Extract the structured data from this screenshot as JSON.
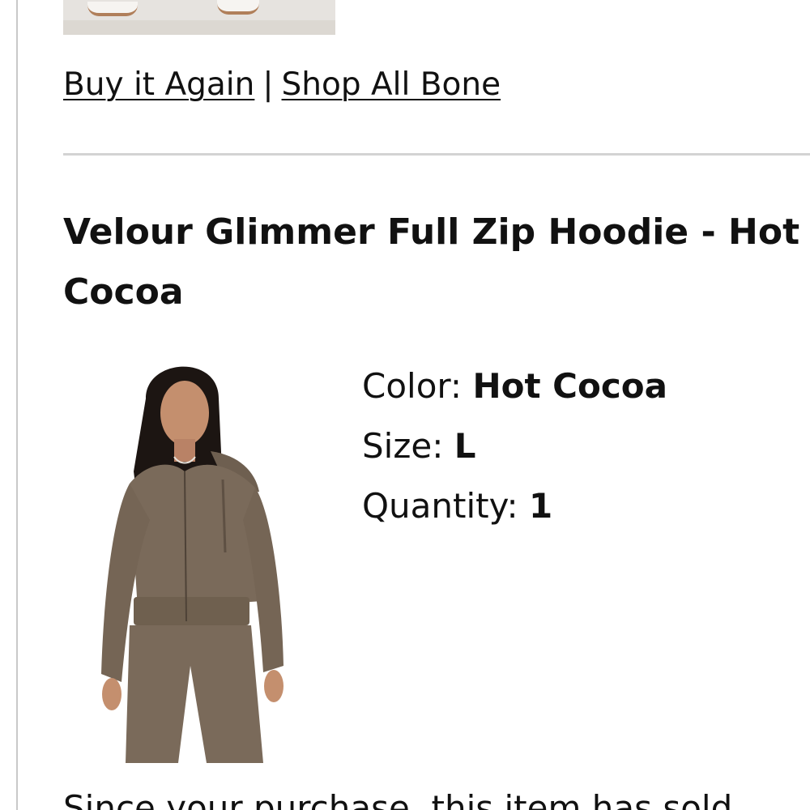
{
  "previous_item": {
    "image_alt": "white sneakers"
  },
  "actions": {
    "buy_again": "Buy it Again",
    "separator": "|",
    "shop_all": "Shop All Bone"
  },
  "product": {
    "title": "Velour Glimmer Full Zip Hoodie - Hot Cocoa",
    "color_label": "Color:",
    "color_value": "Hot Cocoa",
    "size_label": "Size:",
    "size_value": "L",
    "quantity_label": "Quantity:",
    "quantity_value": "1",
    "image_colors": {
      "garment": "#7a6a5a",
      "hair": "#1c1512",
      "skin": "#c48f6e"
    }
  },
  "notice": {
    "text": "Since your purchase, this item has sold"
  }
}
